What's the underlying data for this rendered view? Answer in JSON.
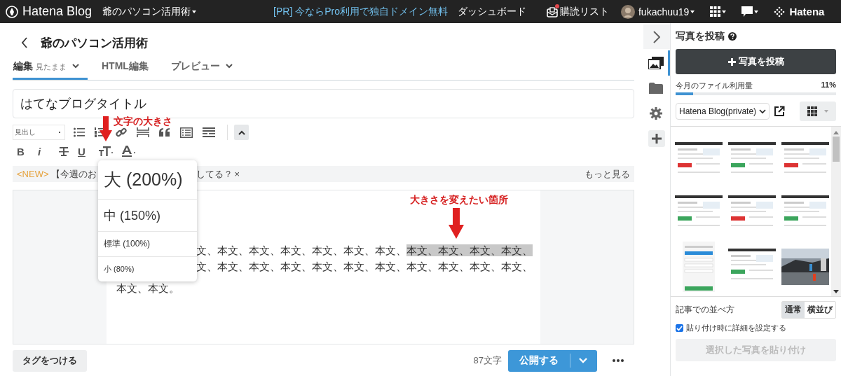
{
  "top_bar": {
    "logo": "Hatena Blog",
    "blog_menu": "爺のパソコン活用術",
    "promo": "[PR] 今ならPro利用で独自ドメイン無料",
    "dashboard": "ダッシュボード",
    "reading_list": "購読リスト",
    "reading_list_unread": true,
    "user": "fukachuu19",
    "brand": "Hatena"
  },
  "header": {
    "blog_title": "爺のパソコン活用術"
  },
  "tabs": [
    {
      "label": "編集",
      "sub": "見たまま",
      "dropdown": true,
      "selected": true
    },
    {
      "label": "HTML編集",
      "dropdown": false,
      "selected": false
    },
    {
      "label": "プレビュー",
      "dropdown": true,
      "selected": false
    }
  ],
  "title_field": {
    "value": "はてなブログタイトル"
  },
  "toolbar": {
    "heading_select": "見出し",
    "bold": "B",
    "italic": "i",
    "underline": "U"
  },
  "notice": {
    "tag": "<NEW>",
    "text_before": "【今週のお",
    "text_after": "してる？",
    "close": "×",
    "more": "もっと見る"
  },
  "size_menu": {
    "items": [
      {
        "kind": "large",
        "label": "大 (200%)"
      },
      {
        "kind": "medium",
        "label": "中 (150%)"
      },
      {
        "kind": "normal",
        "label": "標準 (100%)"
      },
      {
        "kind": "small",
        "label": "小 (80%)"
      }
    ]
  },
  "annotations": [
    {
      "text": "文字の大きさ"
    },
    {
      "text": "大きさを変えたい箇所"
    }
  ],
  "body": {
    "lines": [
      {
        "text": "文、本文、本文、本文、本文、本文、本文、",
        "selected_text": "本文、本文、本文、本文、"
      },
      {
        "text": "文、本文、本文、本文、本文、本文、本文、本文、本文、本文、本文、"
      },
      {
        "text": "本文、本文。"
      }
    ]
  },
  "footer": {
    "tag_button": "タグをつける",
    "char_count": "87文字",
    "publish": "公開する"
  },
  "side_icons": [
    {
      "kind": "images",
      "selected": true
    },
    {
      "kind": "folder",
      "selected": false
    },
    {
      "kind": "gear",
      "selected": false
    },
    {
      "kind": "plus",
      "selected": false
    }
  ],
  "side_panel": {
    "title": "写真を投稿",
    "post_button": "写真を投稿",
    "usage_label": "今月のファイル利用量",
    "usage_percent": "11%",
    "usage": {
      "level": 0.11
    },
    "album": "Hatena Blog(private)",
    "arrange_label": "記事での並べ方",
    "arrange_options": [
      {
        "label": "通常",
        "selected": true
      },
      {
        "label": "横並び",
        "selected": false
      }
    ],
    "detail_checkbox": {
      "label": "貼り付け時に詳細を設定する",
      "checked": true
    },
    "paste_button": {
      "label": "選択した写真を貼り付け",
      "disabled": true
    }
  }
}
